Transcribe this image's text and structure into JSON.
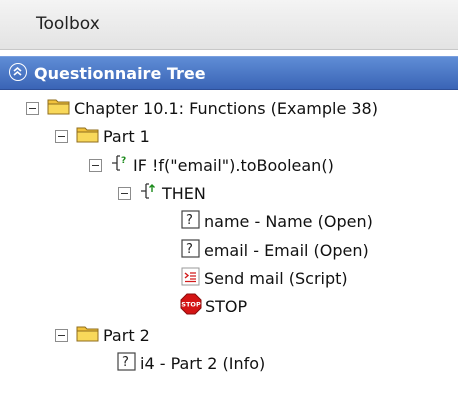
{
  "toolbox": {
    "title": "Toolbox"
  },
  "panel": {
    "title": "Questionnaire Tree"
  },
  "tree": {
    "chapter": "Chapter 10.1: Functions (Example 38)",
    "part1": "Part 1",
    "if_node": "IF !f(\"email\").toBoolean()",
    "then_node": "THEN",
    "q_name": "name - Name (Open)",
    "q_email": "email - Email (Open)",
    "script_node": "Send mail (Script)",
    "stop_node": "STOP",
    "stop_icon_text": "STOP",
    "part2": "Part 2",
    "q_i4": "i4 - Part 2 (Info)"
  },
  "icons": {
    "folder": "folder-icon",
    "condition": "if-branch-icon",
    "then": "then-branch-icon",
    "question": "question-icon",
    "script": "script-icon",
    "stop": "stop-icon",
    "collapse": "collapse-chevron-icon"
  },
  "colors": {
    "header_bar": "#3a64b6",
    "folder": "#f2c23c",
    "stop": "#d41414",
    "script": "#d21c1c"
  }
}
